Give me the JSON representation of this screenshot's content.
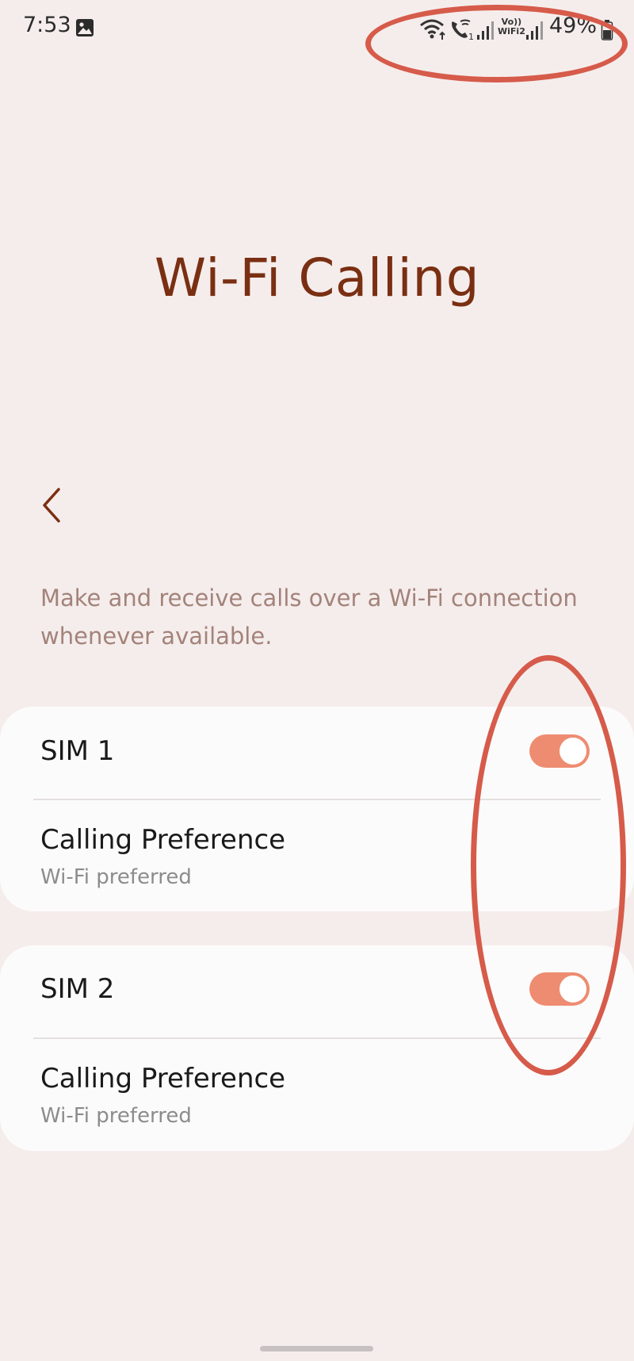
{
  "status_bar": {
    "time": "7:53",
    "battery_percent": "49%",
    "volte_label_line1": "Vo))",
    "volte_label_line2": "WiFi2",
    "icons": [
      "gallery-icon",
      "wifi-icon",
      "wifi-call-icon",
      "signal-icon",
      "volte-wifi-icon",
      "signal-icon",
      "battery-icon"
    ]
  },
  "page": {
    "title": "Wi-Fi Calling",
    "description": "Make and receive calls over a Wi-Fi connection whenever available."
  },
  "sims": [
    {
      "label": "SIM 1",
      "enabled": true,
      "preference_label": "Calling Preference",
      "preference_value": "Wi-Fi preferred"
    },
    {
      "label": "SIM 2",
      "enabled": true,
      "preference_label": "Calling Preference",
      "preference_value": "Wi-Fi preferred"
    }
  ],
  "colors": {
    "background": "#f5edec",
    "title": "#7a2f12",
    "description": "#a3837a",
    "toggle_on": "#ee8c71",
    "annotation": "#d65b4a"
  }
}
